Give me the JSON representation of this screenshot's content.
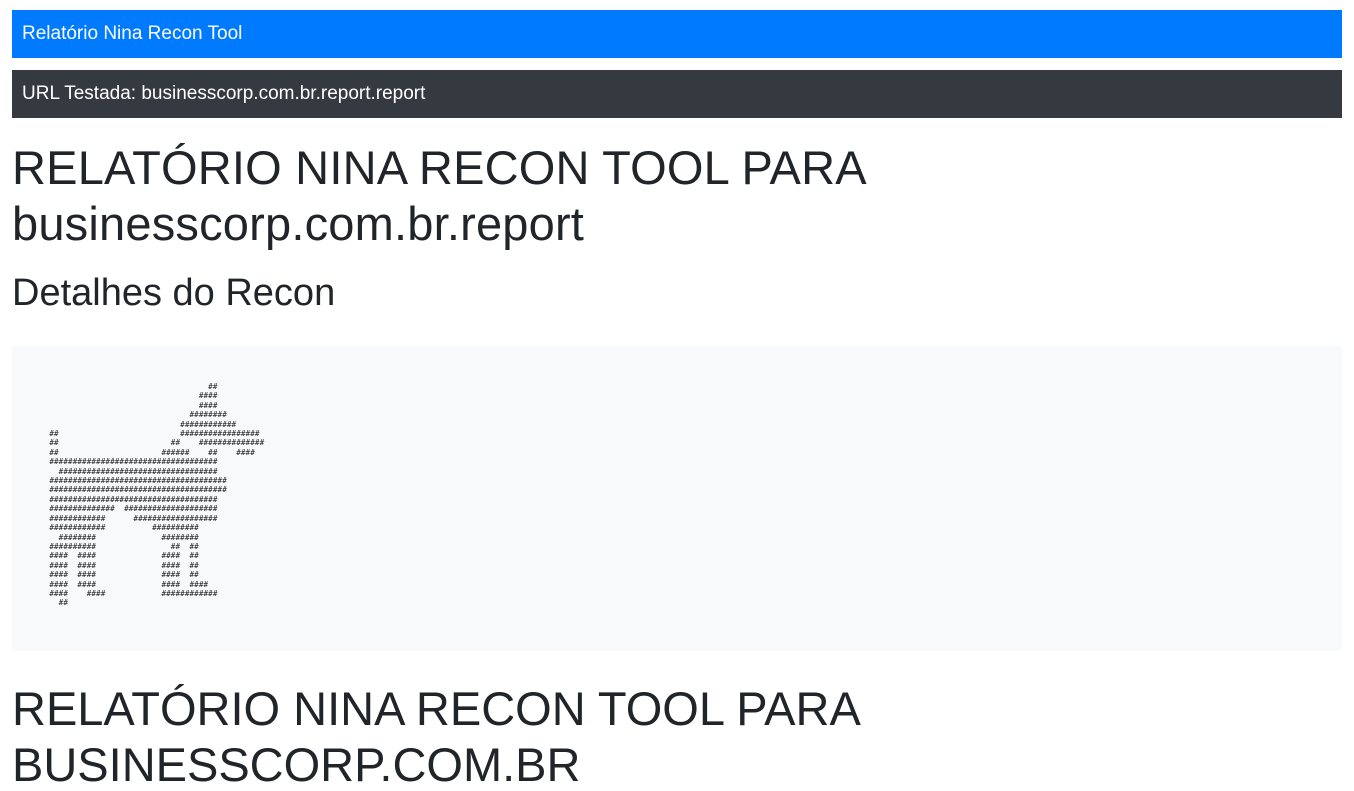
{
  "navbar": {
    "brand": "Relatório Nina Recon Tool"
  },
  "url_bar": {
    "text": "URL Testada: businesscorp.com.br.report.report"
  },
  "main": {
    "title_line1": "RELATÓRIO NINA RECON TOOL PARA",
    "title_line2": "businesscorp.com.br.report",
    "section_heading": "Detalhes do Recon",
    "ascii_art": "                                    ##\n                                  ####\n                                  ####\n                                ########\n                              ############\n  ##                          #################\n  ##                        ##    ##############\n  ##                      ######    ##    ####\n  ####################################\n    ##################################\n  ######################################\n  ######################################\n  ####################################\n  ##############  ####################\n  ############      ##################\n  ############          ##########\n    ########              ########\n  ##########                ##  ##\n  ####  ####              ####  ##\n  ####  ####              ####  ##\n  ####  ####              ####  ##\n  ####  ####              ####  ####\n  ####    ####            ############\n    ##",
    "title2_line1": "RELATÓRIO NINA RECON TOOL PARA",
    "title2_line2": "BUSINESSCORP.COM.BR"
  }
}
